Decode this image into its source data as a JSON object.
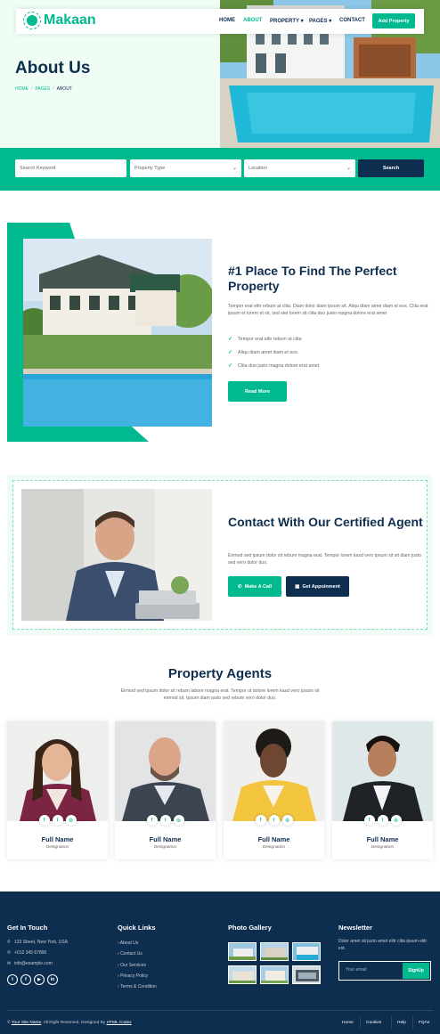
{
  "brand": {
    "name": "Makaan"
  },
  "nav": {
    "items": [
      {
        "label": "HOME",
        "active": false
      },
      {
        "label": "ABOUT",
        "active": true
      },
      {
        "label": "PROPERTY",
        "dropdown": true
      },
      {
        "label": "PAGES",
        "dropdown": true
      },
      {
        "label": "CONTACT",
        "active": false
      }
    ],
    "cta": "Add Property"
  },
  "header": {
    "title": "About Us",
    "breadcrumb": [
      "HOME",
      "PAGES",
      "ABOUT"
    ]
  },
  "search": {
    "keyword_placeholder": "Search Keyword",
    "type_selected": "Property Type",
    "location_selected": "Location",
    "button": "Search"
  },
  "about": {
    "title": "#1 Place To Find The Perfect Property",
    "description": "Tempor erat elitr rebum at clita. Diam dolor diam ipsum sit. Aliqu diam amet diam et eos. Clita erat ipsum et lorem et sit, sed stet lorem sit clita duo justo magna dolore erat amet",
    "points": [
      "Tempor erat elitr rebum at clita",
      "Aliqu diam amet diam et eos",
      "Clita duo justo magna dolore erat amet"
    ],
    "button": "Read More"
  },
  "contact": {
    "title": "Contact With Our Certified Agent",
    "description": "Eirmod sed ipsum dolor sit rebum magna erat. Tempor lorem kasd vero ipsum sit sit diam justo sed vero dolor duo.",
    "call_button": "Make A Call",
    "appointment_button": "Get Appoinment"
  },
  "agents": {
    "title": "Property Agents",
    "description": "Eirmod sed ipsum dolor sit rebum labore magna erat. Tempor ut dolore lorem kasd vero ipsum sit eirmod sit. Ipsum diam justo sed rebum vero dolor duo.",
    "list": [
      {
        "name": "Full Name",
        "role": "Designation"
      },
      {
        "name": "Full Name",
        "role": "Designation"
      },
      {
        "name": "Full Name",
        "role": "Designation"
      },
      {
        "name": "Full Name",
        "role": "Designation"
      }
    ]
  },
  "footer": {
    "get_in_touch": {
      "heading": "Get In Touch",
      "address": "123 Street, New York, USA",
      "phone": "+012 345 67890",
      "email": "info@example.com"
    },
    "quick_links": {
      "heading": "Quick Links",
      "links": [
        "About Us",
        "Contact Us",
        "Our Services",
        "Privacy Policy",
        "Terms & Condition"
      ]
    },
    "gallery": {
      "heading": "Photo Gallery"
    },
    "newsletter": {
      "heading": "Newsletter",
      "description": "Dolor amet sit justo amet elitr clita ipsum elitr est.",
      "placeholder": "Your email",
      "button": "SignUp"
    },
    "copyright": {
      "symbol": "©",
      "site_name": "Your Site Name",
      "rights": ", All Right Reserved. Designed By",
      "designer": "HTML Codex"
    },
    "bottom_links": [
      "Home",
      "Cookies",
      "Help",
      "FQAs"
    ]
  },
  "colors": {
    "primary": "#00B98E",
    "dark": "#0E2E50",
    "light": "#EFFDF5"
  }
}
